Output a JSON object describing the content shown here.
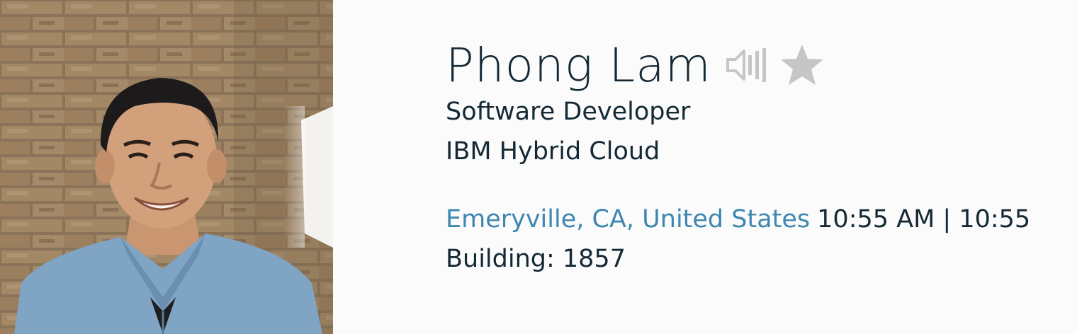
{
  "profile": {
    "name": "Phong Lam",
    "job_title": "Software Developer",
    "organization": "IBM Hybrid Cloud",
    "location": "Emeryville, CA, United States",
    "local_time": "10:55 AM | 10:55",
    "building": "Building: 1857"
  },
  "icons": {
    "pronunciation": "speaker-icon",
    "favorite": "star-icon"
  },
  "colors": {
    "text": "#152935",
    "link": "#3f86b1",
    "icon_gray": "#c6c6c6",
    "background": "#fbfbfb"
  }
}
